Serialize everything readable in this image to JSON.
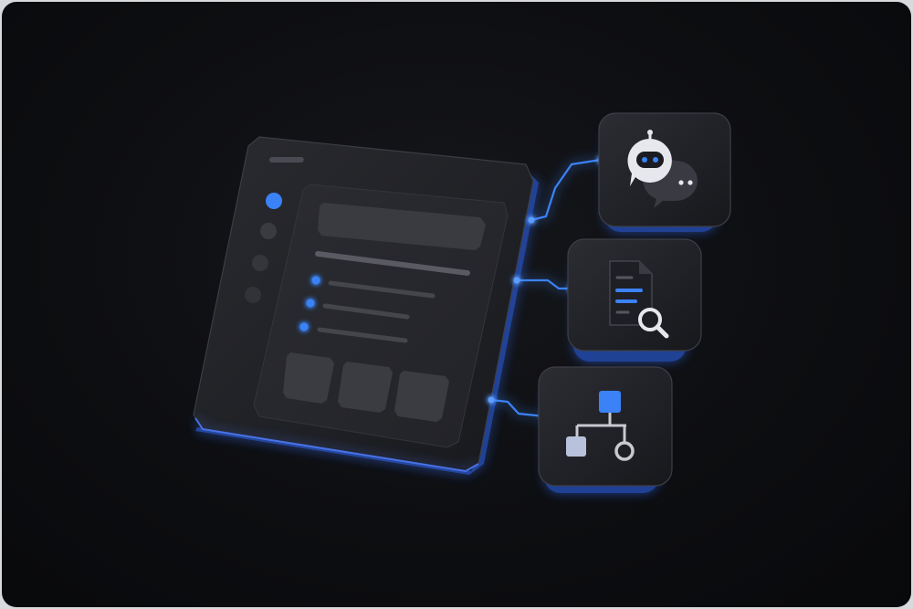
{
  "theme": {
    "accent": "#3b82f6",
    "glow": "#2f6bff",
    "panel": "#1c1d21",
    "panel_inner": "#25262b",
    "muted": "#3a3b41",
    "bright": "#e6e8ee"
  },
  "main_window": {
    "nav_items": [
      "active-dot",
      "dot",
      "dot",
      "dot"
    ],
    "list_bullets": 3,
    "content_cards": 3
  },
  "integrations": [
    {
      "icon": "chatbot-icon"
    },
    {
      "icon": "document-search-icon"
    },
    {
      "icon": "workflow-icon"
    }
  ]
}
